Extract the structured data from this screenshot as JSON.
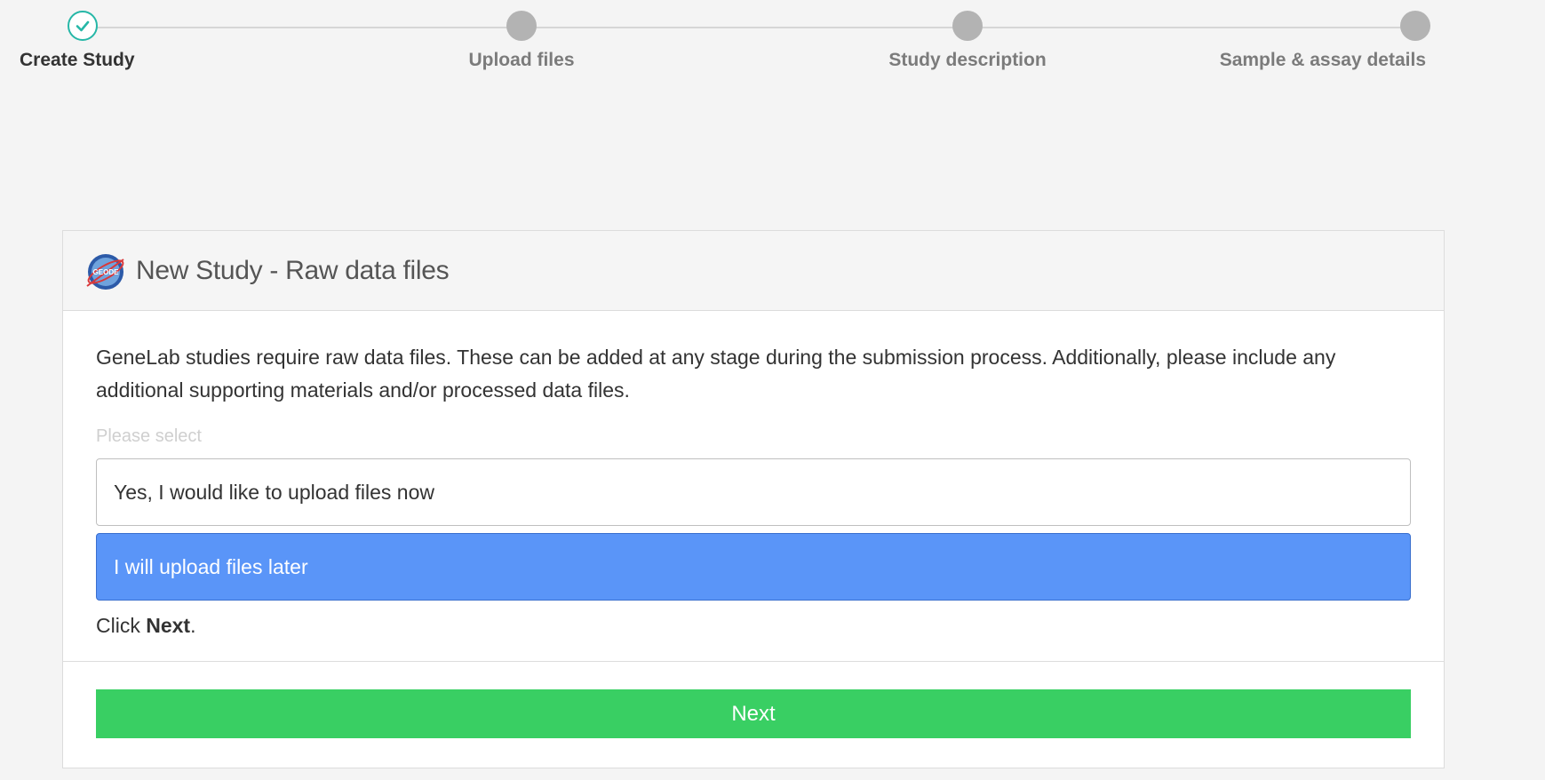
{
  "stepper": {
    "accent": "#26b7a7",
    "steps": [
      {
        "label": "Create Study",
        "state": "done"
      },
      {
        "label": "Upload files",
        "state": "pending"
      },
      {
        "label": "Study description",
        "state": "pending"
      },
      {
        "label": "Sample & assay details",
        "state": "pending"
      }
    ]
  },
  "panel": {
    "logo_icon": "genelab-logo",
    "logo_text": "GEODE",
    "title": "New Study - Raw data files",
    "description": "GeneLab studies require raw data files. These can be added at any stage during the submission process. Additionally, please include any additional supporting materials and/or processed data files.",
    "select_label": "Please select",
    "options": [
      {
        "label": "Yes, I would like to upload files now",
        "selected": false
      },
      {
        "label": "I will upload files later",
        "selected": true
      }
    ],
    "hint_prefix": "Click ",
    "hint_bold": "Next",
    "hint_suffix": ".",
    "next_label": "Next",
    "colors": {
      "selected": "#5a95f8",
      "next": "#39cf63"
    }
  }
}
